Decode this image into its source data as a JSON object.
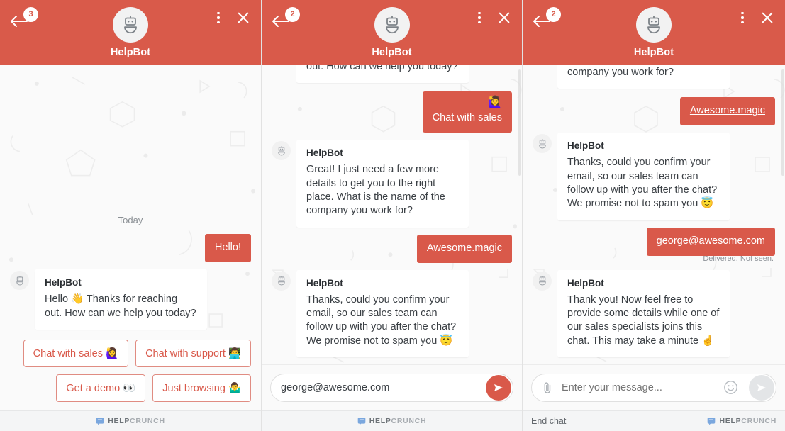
{
  "brand": {
    "part1": "HELP",
    "part2": "CRUNCH",
    "icon": "chat-bubble-icon"
  },
  "accent_color": "#d9594a",
  "header": {
    "title": "HelpBot",
    "avatar_icon": "robot-icon",
    "menu_icon": "more-vertical-icon",
    "close_icon": "close-icon",
    "back_icon": "arrow-left-icon"
  },
  "panels": [
    {
      "id": "panel-1",
      "badge": "3",
      "day_separator": "Today",
      "messages": [
        {
          "type": "out",
          "text": "Hello!"
        },
        {
          "type": "in",
          "sender": "HelpBot",
          "text": "Hello 👋 Thanks for reaching out. How can we help you today?"
        }
      ],
      "quick_replies": [
        {
          "label": "Chat with sales 🙋‍♀️"
        },
        {
          "label": "Chat with support 👨‍💻"
        },
        {
          "label": "Get a demo 👀"
        },
        {
          "label": "Just browsing 🤷‍♂️"
        }
      ],
      "composer": null,
      "footer": {
        "end_chat": null
      }
    },
    {
      "id": "panel-2",
      "badge": "2",
      "messages": [
        {
          "type": "in",
          "sender": null,
          "text": "Hello 👋 Thanks for reaching out. How can we help you today?",
          "clipped_top": true
        },
        {
          "type": "out",
          "text": "Chat with sales",
          "emoji": "🙋‍♀️"
        },
        {
          "type": "in",
          "sender": "HelpBot",
          "text": "Great! I just need a few more details to get you to the right place. What is the name of the company you work for?"
        },
        {
          "type": "out",
          "text": "Awesome.magic",
          "link": true
        },
        {
          "type": "in",
          "sender": "HelpBot",
          "text": "Thanks, could you confirm your email, so our sales team can follow up with you after the chat? We promise not to spam you 😇"
        }
      ],
      "quick_replies": [],
      "composer": {
        "value": "george@awesome.com",
        "placeholder": "Enter your message...",
        "send_icon": "send-icon",
        "send_active": true,
        "show_clip": false,
        "show_emoji": false
      },
      "footer": {
        "end_chat": null
      }
    },
    {
      "id": "panel-3",
      "badge": "2",
      "messages": [
        {
          "type": "in",
          "sender": null,
          "text": "place. What is the name of the company you work for?",
          "clipped_top": true
        },
        {
          "type": "out",
          "text": "Awesome.magic",
          "link": true
        },
        {
          "type": "in",
          "sender": "HelpBot",
          "text": "Thanks, could you confirm your email, so our sales team can follow up with you after the chat? We promise not to spam you 😇"
        },
        {
          "type": "out",
          "text": "george@awesome.com",
          "link": true,
          "status": "Delivered. Not seen."
        },
        {
          "type": "in",
          "sender": "HelpBot",
          "text": "Thank you! Now feel free to provide some details while one of our sales specialists joins this chat. This may take a minute ☝️"
        }
      ],
      "quick_replies": [],
      "composer": {
        "value": "",
        "placeholder": "Enter your message...",
        "send_icon": "send-icon",
        "send_active": false,
        "show_clip": true,
        "show_emoji": true,
        "clip_icon": "paperclip-icon",
        "emoji_icon": "smiley-icon"
      },
      "footer": {
        "end_chat": "End chat"
      }
    }
  ]
}
